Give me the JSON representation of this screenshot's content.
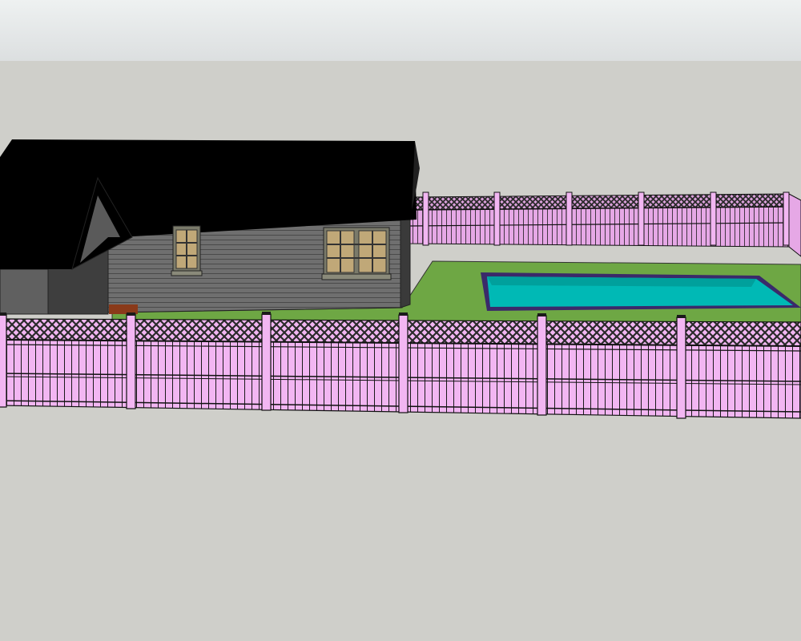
{
  "viewport": {
    "sky_color": "#dfe3e4",
    "ground_color": "#cfcfca",
    "icon": "3d-model-viewport"
  },
  "scene": {
    "components": [
      "pool-house",
      "back-fence",
      "front-fence",
      "lawn",
      "swimming-pool"
    ],
    "colors": {
      "fence": "#f2b6f2",
      "fence_outline": "#111111",
      "lattice_dark": "#2a2a2a",
      "roof": "#000000",
      "siding": "#6f6f6f",
      "side_wall": "#4f4f4f",
      "shadow_wall": "#3a3a3a",
      "lawn": "#6ea744",
      "pool_water": "#00b9b5",
      "pool_rim": "#3a2a6a",
      "window_frame": "#7a7a6a",
      "window_pane": "#c0a878",
      "deck": "#8a3a1a"
    }
  }
}
